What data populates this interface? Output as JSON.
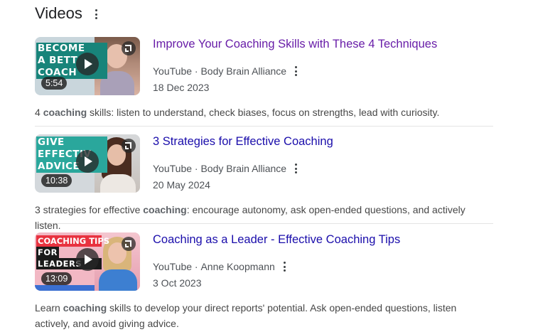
{
  "header": {
    "title": "Videos"
  },
  "videos": [
    {
      "title": "Improve Your Coaching Skills with These 4 Techniques",
      "visited": true,
      "duration": "5:54",
      "source": "YouTube",
      "channel": "Body Brain Alliance",
      "date": "18 Dec 2023",
      "snippet": [
        "4 ",
        "coaching",
        " skills: listen to understand, check biases, focus on strengths, lead with curiosity."
      ],
      "thumb_lines": [
        "BECOME",
        "A BETT",
        "COACH"
      ]
    },
    {
      "title": "3 Strategies for Effective Coaching",
      "visited": false,
      "duration": "10:38",
      "source": "YouTube",
      "channel": "Body Brain Alliance",
      "date": "20 May 2024",
      "snippet": [
        "3 strategies for effective ",
        "coaching",
        ": encourage autonomy, ask open-ended questions, and actively listen."
      ],
      "thumb_lines": [
        "GIVE",
        "EFFECTIV",
        "ADVICE"
      ]
    },
    {
      "title": "Coaching as a Leader - Effective Coaching Tips",
      "visited": false,
      "duration": "13:09",
      "source": "YouTube",
      "channel": "Anne Koopmann",
      "date": "3 Oct 2023",
      "snippet": [
        "Learn ",
        "coaching",
        " skills to develop your direct reports' potential. Ask open-ended questions, listen actively, and avoid giving advice."
      ],
      "thumb_lines": [
        "COACHING TIPS",
        "FOR",
        "LEADERS"
      ]
    }
  ],
  "colors": {
    "link": "#1a0dab",
    "visited_link": "#681da8",
    "meta_text": "#4d5156"
  }
}
